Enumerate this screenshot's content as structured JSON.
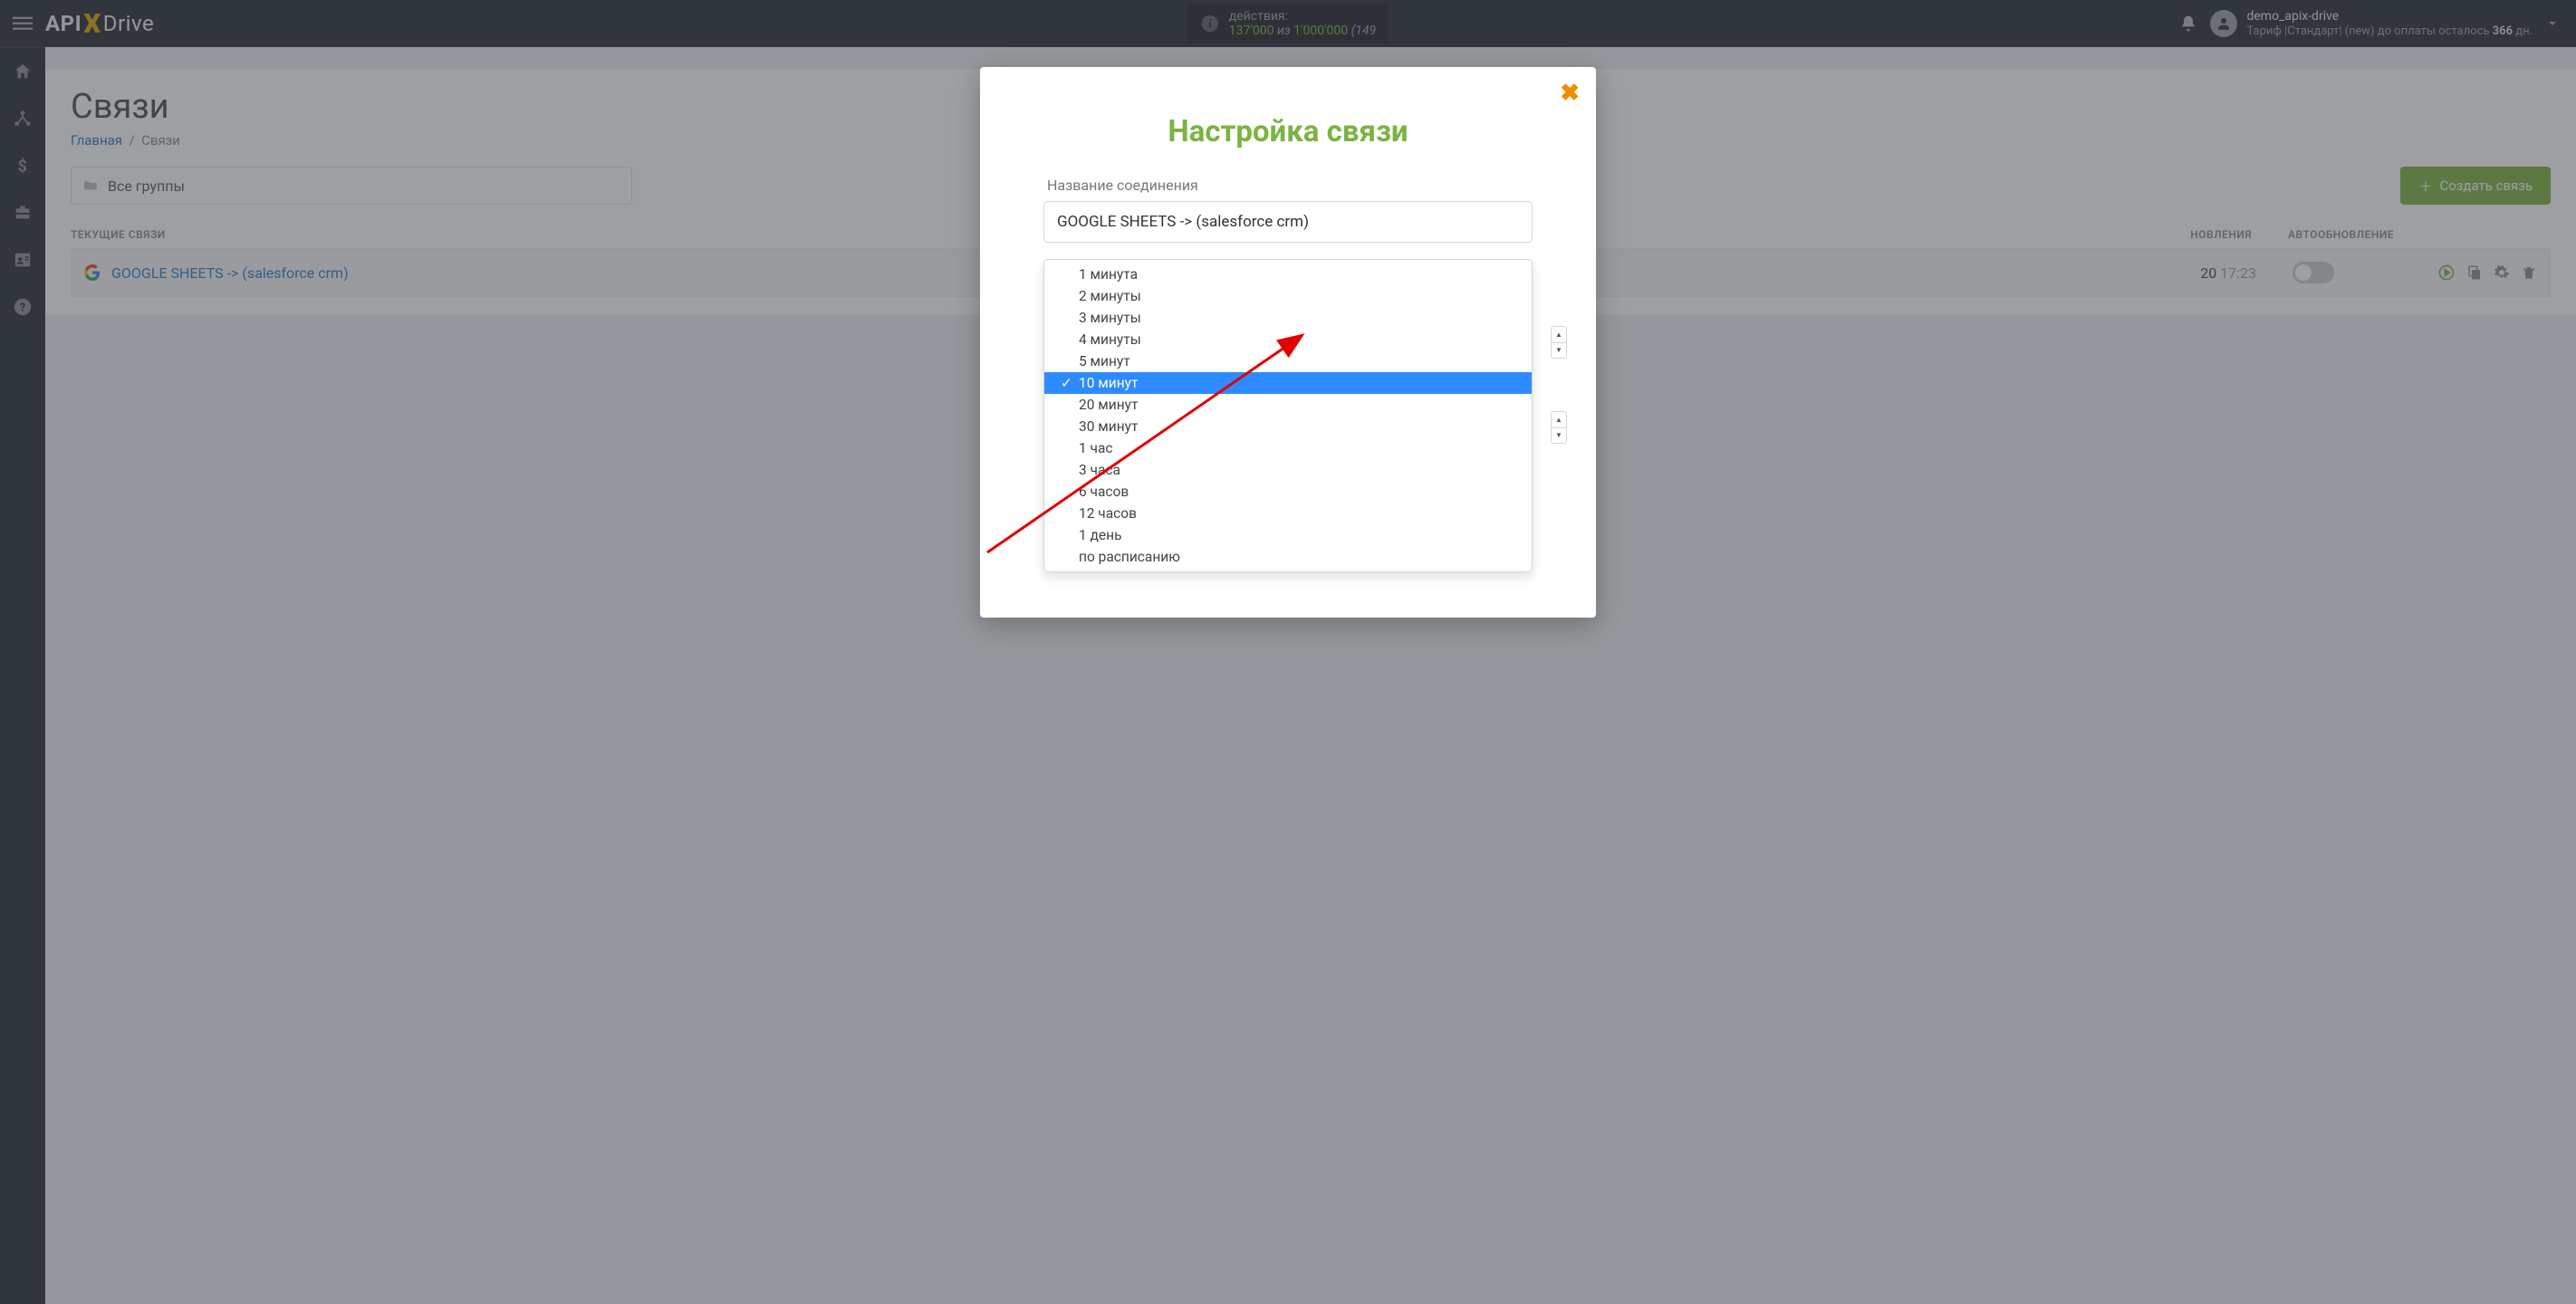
{
  "header": {
    "logo_parts": {
      "api": "API",
      "x": "X",
      "drive": "Drive"
    },
    "actions_label": "действия:",
    "actions_used": "137'000",
    "actions_of": "из",
    "actions_total": "1'000'000",
    "actions_trail": "(149",
    "user_name": "demo_apix-drive",
    "plan_line_prefix": "Тариф |Стандарт| (new) до оплаты осталось ",
    "plan_days": "366",
    "plan_line_suffix": " дн."
  },
  "page": {
    "title": "Связи",
    "breadcrumb_home": "Главная",
    "breadcrumb_current": "Связи",
    "group_filter": "Все группы",
    "create_button": "Создать связь",
    "columns": {
      "current": "ТЕКУЩИЕ СВЯЗИ",
      "date": "НОВЛЕНИЯ",
      "auto": "АВТООБНОВЛЕНИЕ"
    }
  },
  "row": {
    "name": "GOOGLE SHEETS -> (salesforce crm)",
    "date_part": "20",
    "time_part": "17:23"
  },
  "modal": {
    "title": "Настройка связи",
    "name_label": "Название соединения",
    "name_value": "GOOGLE SHEETS -> (salesforce crm)",
    "interval_options": [
      "1 минута",
      "2 минуты",
      "3 минуты",
      "4 минуты",
      "5 минут",
      "10 минут",
      "20 минут",
      "30 минут",
      "1 час",
      "3 часа",
      "6 часов",
      "12 часов",
      "1 день",
      "по расписанию"
    ],
    "selected_index": 5
  }
}
